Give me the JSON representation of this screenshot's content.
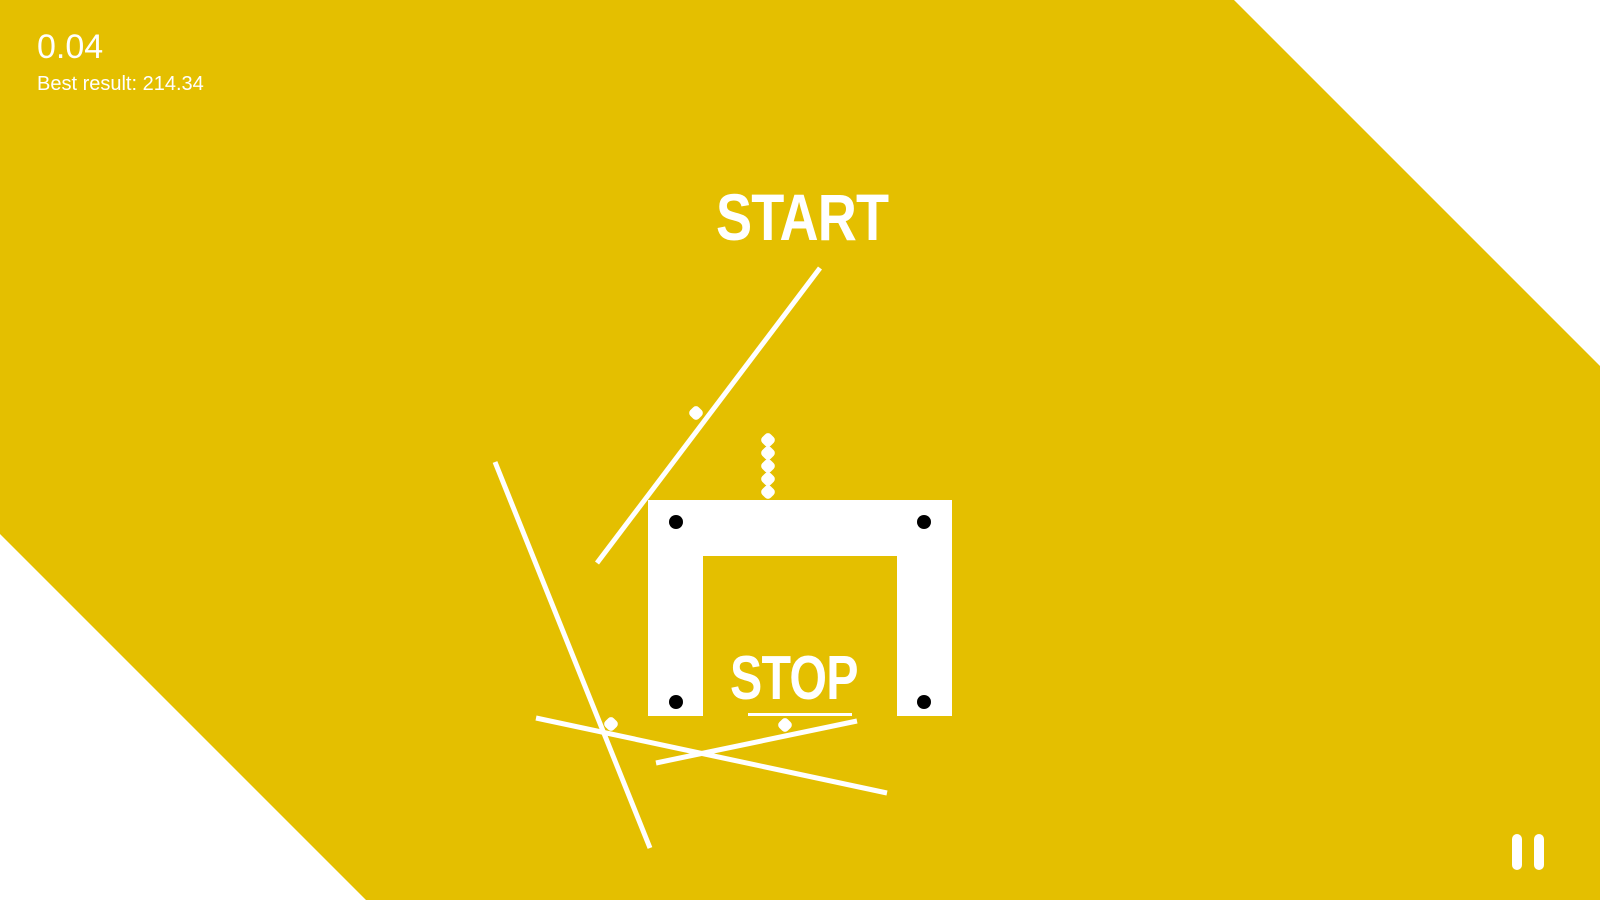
{
  "hud": {
    "timer": "0.04",
    "best_result": "Best result: 214.34"
  },
  "level": {
    "start_label": "START",
    "stop_label": "STOP"
  },
  "colors": {
    "background": "#E4BF00",
    "outside": "#FFFFFF",
    "objects": "#FFFFFF",
    "pins": "#000000"
  },
  "icons": {
    "pause": "pause-icon"
  }
}
